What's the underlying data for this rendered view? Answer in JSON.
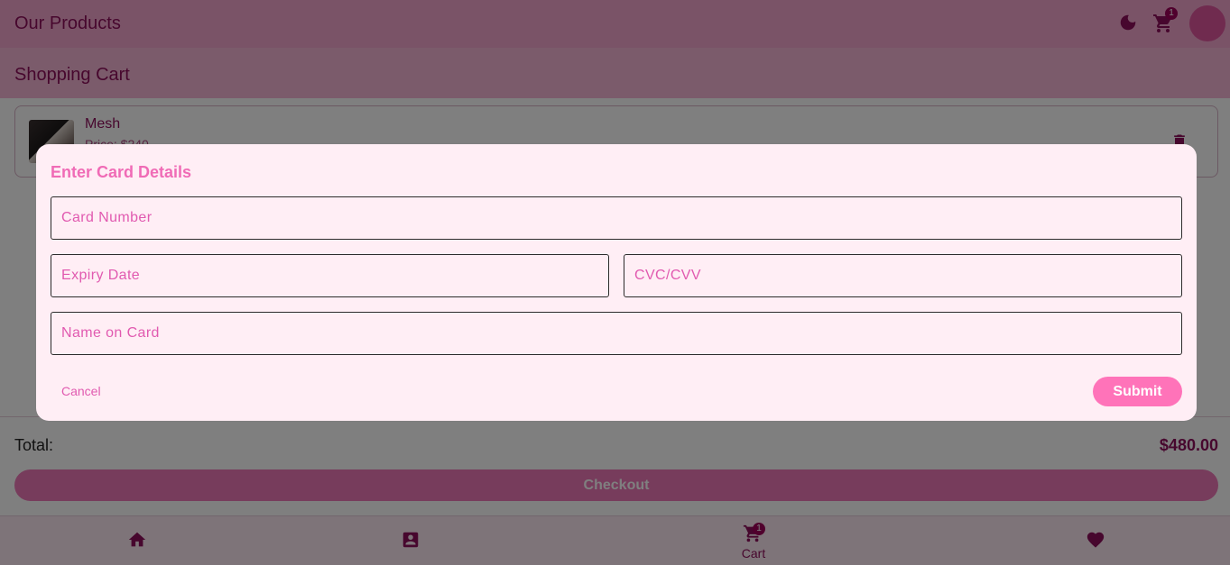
{
  "appbar": {
    "title": "Our Products",
    "cart_badge": "1",
    "icons": [
      "moon-icon",
      "cart-icon",
      "avatar"
    ]
  },
  "cart_section": {
    "title": "Shopping Cart",
    "items": [
      {
        "name": "Mesh",
        "price": "Price: $240"
      }
    ]
  },
  "summary": {
    "total_label": "Total:",
    "total_value": "$480.00",
    "checkout_label": "Checkout"
  },
  "bottom_nav": {
    "items": [
      {
        "icon": "home-icon",
        "label": ""
      },
      {
        "icon": "account-box-icon",
        "label": ""
      },
      {
        "icon": "cart-icon",
        "label": "Cart",
        "badge": "1"
      },
      {
        "icon": "heart-icon",
        "label": ""
      }
    ]
  },
  "dialog": {
    "title": "Enter Card Details",
    "fields": {
      "card_number": {
        "placeholder": "Card Number",
        "value": ""
      },
      "expiry": {
        "placeholder": "Expiry Date",
        "value": ""
      },
      "cvc": {
        "placeholder": "CVC/CVV",
        "value": ""
      },
      "name": {
        "placeholder": "Name on Card",
        "value": ""
      }
    },
    "cancel_label": "Cancel",
    "submit_label": "Submit"
  },
  "colors": {
    "primary": "#8f0f5c",
    "accent": "#ff73b9",
    "dialog_bg": "#ffeef5"
  }
}
